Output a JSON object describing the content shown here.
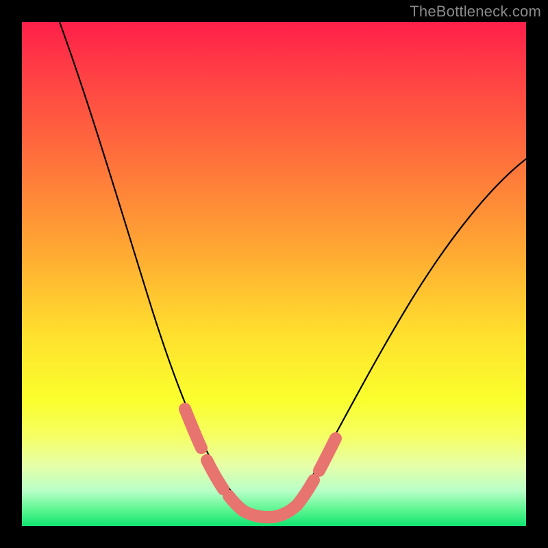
{
  "watermark": "TheBottleneck.com",
  "colors": {
    "frame": "#000000",
    "gradient_top": "#ff1f4a",
    "gradient_bottom": "#10e371",
    "curve": "#000000",
    "highlight": "#e8746f"
  },
  "chart_data": {
    "type": "line",
    "title": "",
    "xlabel": "",
    "ylabel": "",
    "xlim": [
      0,
      100
    ],
    "ylim": [
      0,
      100
    ],
    "series": [
      {
        "name": "bottleneck-curve",
        "x": [
          0,
          4,
          8,
          12,
          16,
          20,
          24,
          28,
          32,
          36,
          40,
          42,
          44,
          46,
          48,
          50,
          52,
          54,
          58,
          62,
          68,
          74,
          82,
          90,
          100
        ],
        "values": [
          110,
          98,
          84,
          70,
          58,
          46,
          36,
          28,
          20,
          13,
          8,
          5,
          3,
          2,
          2,
          2,
          3,
          5,
          10,
          16,
          26,
          36,
          49,
          60,
          72
        ]
      }
    ],
    "annotations": [
      {
        "name": "highlight-left",
        "x_range": [
          30,
          40
        ],
        "note": "descending thick dashed segment"
      },
      {
        "name": "highlight-bottom",
        "x_range": [
          40,
          52
        ],
        "note": "valley thick segment"
      },
      {
        "name": "highlight-right",
        "x_range": [
          52,
          58
        ],
        "note": "ascending thick dashed segment"
      }
    ]
  }
}
